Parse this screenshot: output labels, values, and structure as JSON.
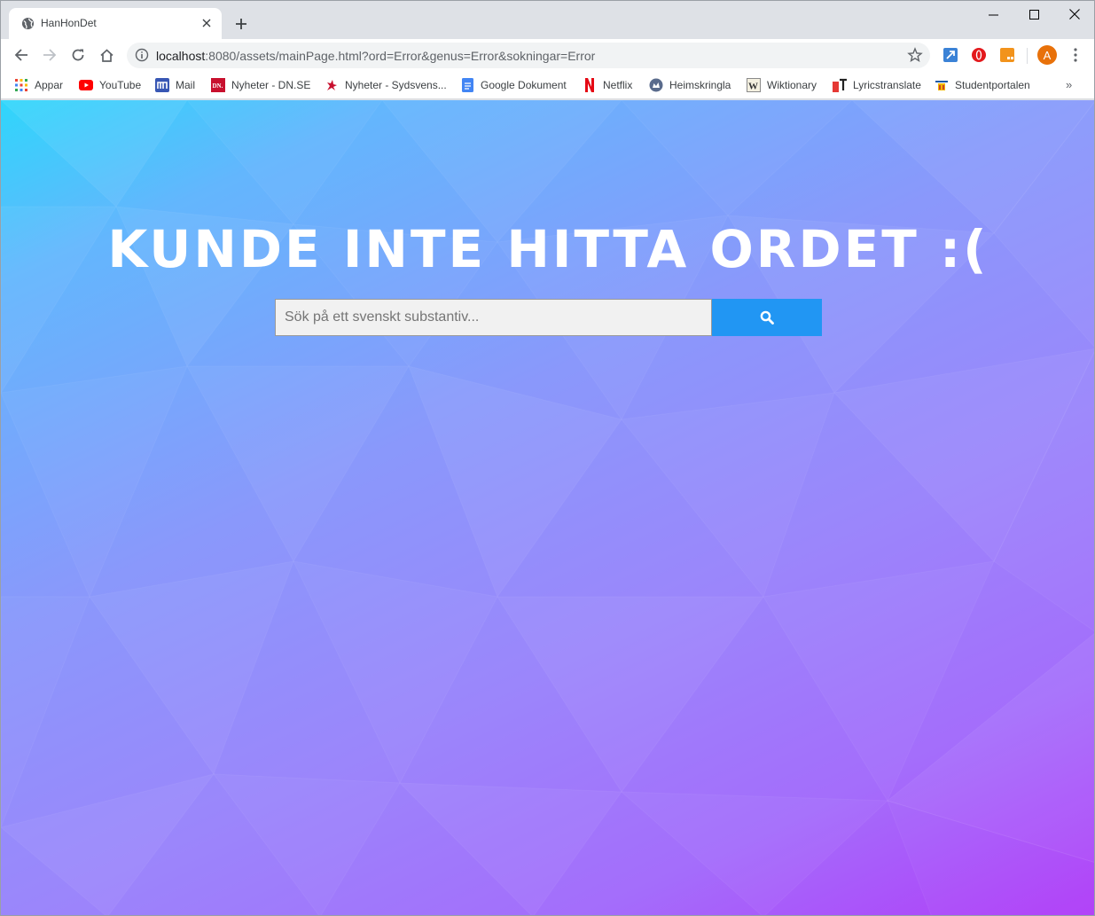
{
  "browser": {
    "tab_title": "HanHonDet",
    "url_host": "localhost",
    "url_rest": ":8080/assets/mainPage.html?ord=Error&genus=Error&sokningar=Error",
    "avatar_letter": "A"
  },
  "bookmarks": [
    {
      "label": "Appar",
      "icon": "apps-grid-icon"
    },
    {
      "label": "YouTube",
      "icon": "youtube-icon"
    },
    {
      "label": "Mail",
      "icon": "mail-icon"
    },
    {
      "label": "Nyheter - DN.SE",
      "icon": "dn-icon"
    },
    {
      "label": "Nyheter - Sydsvens...",
      "icon": "sydsvenskan-icon"
    },
    {
      "label": "Google Dokument",
      "icon": "google-docs-icon"
    },
    {
      "label": "Netflix",
      "icon": "netflix-icon"
    },
    {
      "label": "Heimskringla",
      "icon": "heimskringla-icon"
    },
    {
      "label": "Wiktionary",
      "icon": "wiktionary-icon"
    },
    {
      "label": "Lyricstranslate",
      "icon": "lyricstranslate-icon"
    },
    {
      "label": "Studentportalen",
      "icon": "studentportalen-icon"
    }
  ],
  "page": {
    "headline": "KUNDE INTE HITTA ORDET :(",
    "search_placeholder": "Sök på ett svenskt substantiv...",
    "search_value": ""
  },
  "colors": {
    "gradient_start": "#2fd6fb",
    "gradient_mid": "#8a98fb",
    "gradient_end": "#b03cf8",
    "search_button": "#2196f3",
    "headline": "#ffffff"
  }
}
